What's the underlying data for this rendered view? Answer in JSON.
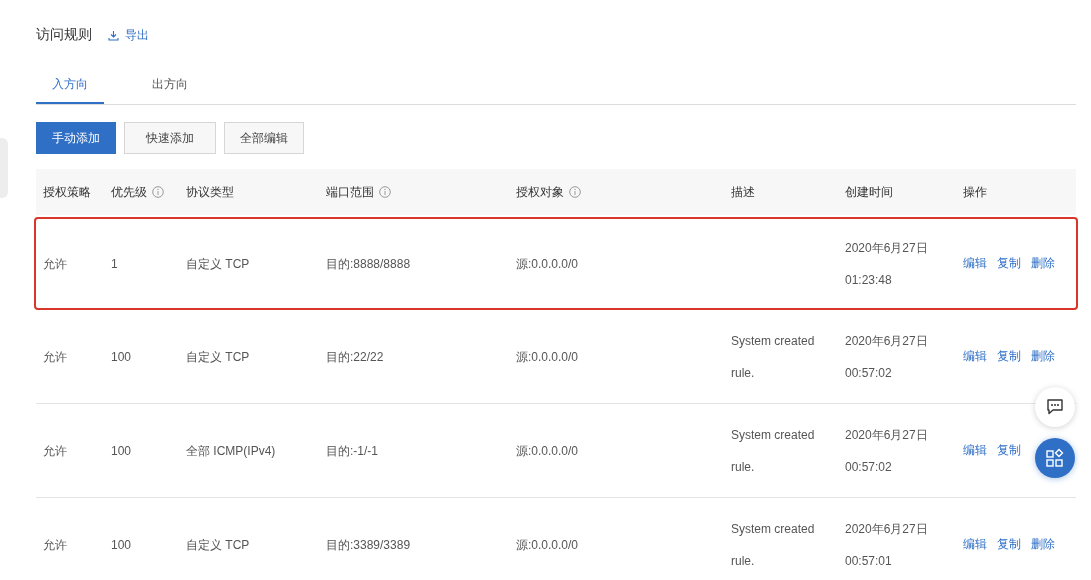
{
  "title": "访问规则",
  "export_link": "导出",
  "tabs": [
    {
      "label": "入方向",
      "selected": true
    },
    {
      "label": "出方向",
      "selected": false
    }
  ],
  "buttons": [
    {
      "label": "手动添加",
      "kind": "primary"
    },
    {
      "label": "快速添加",
      "kind": "default"
    },
    {
      "label": "全部编辑",
      "kind": "default"
    }
  ],
  "table": {
    "columns": [
      {
        "label": "授权策略",
        "info": false
      },
      {
        "label": "优先级",
        "info": true
      },
      {
        "label": "协议类型",
        "info": false
      },
      {
        "label": "端口范围",
        "info": true
      },
      {
        "label": "授权对象",
        "info": true
      },
      {
        "label": "描述",
        "info": false
      },
      {
        "label": "创建时间",
        "info": false
      },
      {
        "label": "操作",
        "info": false
      }
    ],
    "rows": [
      {
        "highlighted": true,
        "policy": "允许",
        "priority": "1",
        "protocol": "自定义 TCP",
        "port": "目的:8888/8888",
        "object": "源:0.0.0.0/0",
        "created_date": "2020年6月27日",
        "created_time": "01:23:48",
        "actions": [
          "编辑",
          "复制",
          "删除"
        ]
      },
      {
        "highlighted": false,
        "policy": "允许",
        "priority": "100",
        "protocol": "自定义 TCP",
        "port": "目的:22/22",
        "object": "源:0.0.0.0/0",
        "description": "System created rule.",
        "created_date": "2020年6月27日",
        "created_time": "00:57:02",
        "actions": [
          "编辑",
          "复制",
          "删除"
        ]
      },
      {
        "highlighted": false,
        "policy": "允许",
        "priority": "100",
        "protocol": "全部 ICMP(IPv4)",
        "port": "目的:-1/-1",
        "object": "源:0.0.0.0/0",
        "description": "System created rule.",
        "created_date": "2020年6月27日",
        "created_time": "00:57:02",
        "actions": [
          "编辑",
          "复制"
        ]
      },
      {
        "highlighted": false,
        "policy": "允许",
        "priority": "100",
        "protocol": "自定义 TCP",
        "port": "目的:3389/3389",
        "object": "源:0.0.0.0/0",
        "description": "System created rule.",
        "created_date": "2020年6月27日",
        "created_time": "00:57:01",
        "actions": [
          "编辑",
          "复制",
          "删除"
        ]
      }
    ]
  }
}
